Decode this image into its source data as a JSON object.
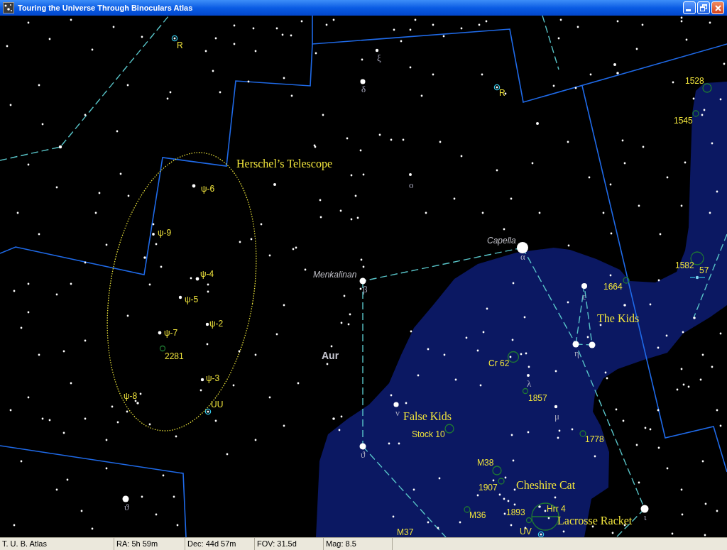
{
  "window": {
    "title": "Touring the Universe Through Binoculars Atlas"
  },
  "map": {
    "labels": [
      {
        "kind": "object",
        "text": "R"
      },
      {
        "kind": "greek",
        "text": "ξ"
      },
      {
        "kind": "greek",
        "text": "δ"
      },
      {
        "kind": "object",
        "text": "1528"
      },
      {
        "kind": "object",
        "text": "R"
      },
      {
        "kind": "object",
        "text": "1545"
      },
      {
        "kind": "asterism",
        "text": "Herschel’s Telescope"
      },
      {
        "kind": "object",
        "text": "ψ-6"
      },
      {
        "kind": "greek",
        "text": "ο"
      },
      {
        "kind": "object",
        "text": "ψ-9"
      },
      {
        "kind": "star_name",
        "text": "Capella"
      },
      {
        "kind": "greek",
        "text": "α"
      },
      {
        "kind": "object",
        "text": "ψ-4"
      },
      {
        "kind": "star_name",
        "text": "Menkalinan"
      },
      {
        "kind": "object",
        "text": "1582"
      },
      {
        "kind": "object",
        "text": "57"
      },
      {
        "kind": "greek",
        "text": "β"
      },
      {
        "kind": "object",
        "text": "1664"
      },
      {
        "kind": "object",
        "text": "ψ-5"
      },
      {
        "kind": "greek",
        "text": "ε"
      },
      {
        "kind": "object",
        "text": "ψ-2"
      },
      {
        "kind": "asterism",
        "text": "The Kids"
      },
      {
        "kind": "object",
        "text": "ψ-7"
      },
      {
        "kind": "object",
        "text": "2281"
      },
      {
        "kind": "constellation",
        "text": "Aur"
      },
      {
        "kind": "greek",
        "text": "η"
      },
      {
        "kind": "object",
        "text": "Cr 62"
      },
      {
        "kind": "object",
        "text": "ψ-3"
      },
      {
        "kind": "greek",
        "text": "λ"
      },
      {
        "kind": "object",
        "text": "ψ-8"
      },
      {
        "kind": "object",
        "text": "UU"
      },
      {
        "kind": "object",
        "text": "1857"
      },
      {
        "kind": "greek",
        "text": "ν"
      },
      {
        "kind": "asterism",
        "text": "False Kids"
      },
      {
        "kind": "greek",
        "text": "μ"
      },
      {
        "kind": "object",
        "text": "Stock 10"
      },
      {
        "kind": "object",
        "text": "1778"
      },
      {
        "kind": "greek",
        "text": "ϑ"
      },
      {
        "kind": "object",
        "text": "M38"
      },
      {
        "kind": "object",
        "text": "1907"
      },
      {
        "kind": "asterism",
        "text": "Cheshire Cat"
      },
      {
        "kind": "greek",
        "text": "ϑ"
      },
      {
        "kind": "object",
        "text": "M36"
      },
      {
        "kind": "object",
        "text": "1893"
      },
      {
        "kind": "object",
        "text": "Hrr 4"
      },
      {
        "kind": "asterism",
        "text": "Lacrosse Racket"
      },
      {
        "kind": "greek",
        "text": "ι"
      },
      {
        "kind": "object",
        "text": "M37"
      },
      {
        "kind": "object",
        "text": "UV"
      }
    ]
  },
  "status_bar": {
    "fields": [
      "T. U. B. Atlas",
      "RA: 5h 59m",
      "Dec: 44d 57m",
      "FOV: 31.5d",
      "Mag: 8.5"
    ]
  }
}
